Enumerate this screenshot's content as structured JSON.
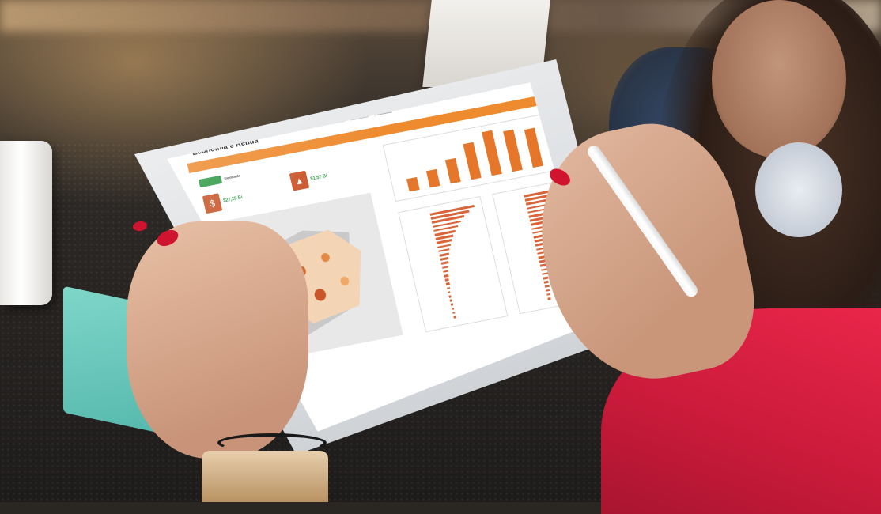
{
  "scene": {
    "colors": {
      "accent_orange": "#ee8b2f",
      "map_orange": "#d3692a",
      "brand_green": "#2f9a45",
      "nail_red": "#d0142f",
      "shirt_red": "#e9264a"
    }
  },
  "dashboard": {
    "page_title": "Economia e Renda",
    "section_title": "Exportação",
    "kpis": [
      {
        "icon": "dollar-icon",
        "value": "$27,28 Bi"
      },
      {
        "icon": "bag-icon",
        "value": "$1,57 Bi"
      }
    ],
    "chart_data": {
      "type": "bar",
      "values": [
        30,
        38,
        55,
        82,
        100,
        92,
        88,
        80
      ]
    }
  }
}
